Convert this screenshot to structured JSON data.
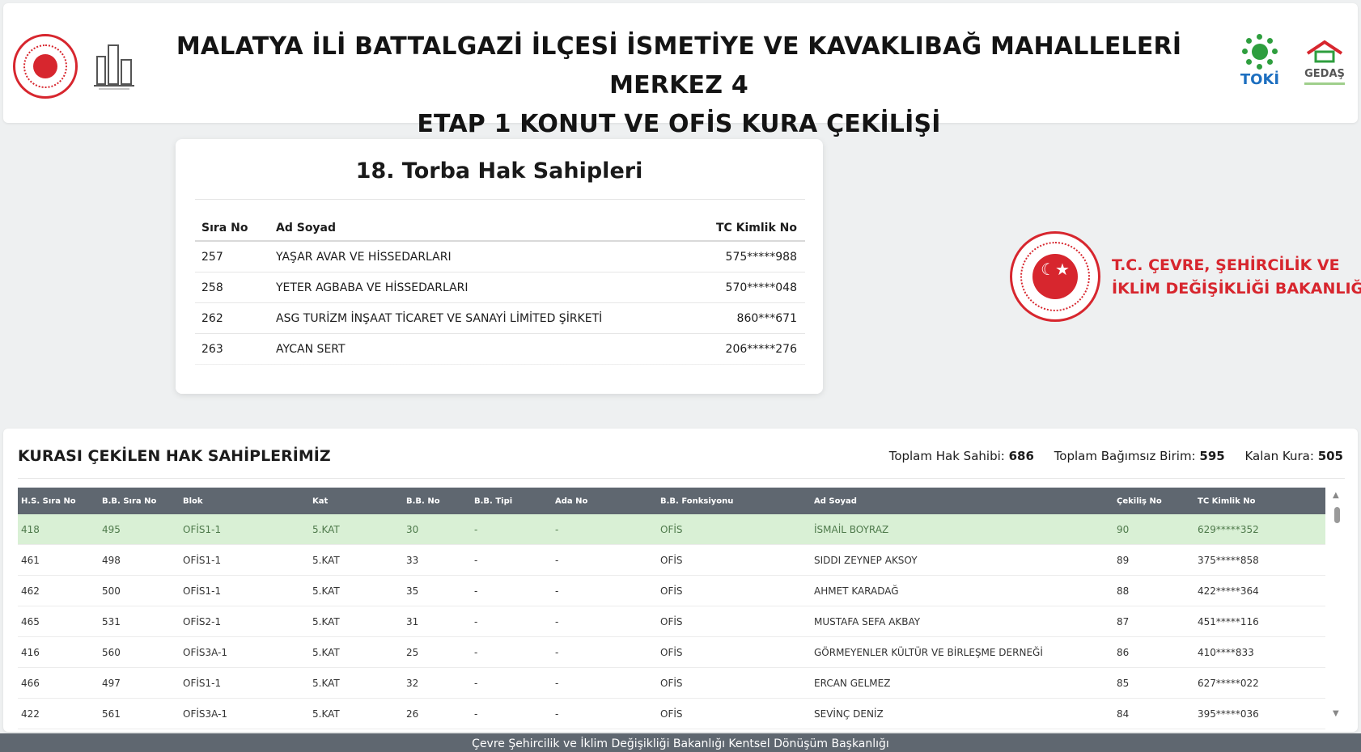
{
  "header": {
    "title_line1": "MALATYA İLİ BATTALGAZİ İLÇESİ İSMETİYE VE KAVAKLIBAĞ MAHALLELERİ MERKEZ 4",
    "title_line2": "ETAP 1 KONUT VE OFİS KURA ÇEKİLİŞİ",
    "toki_label": "TOKİ",
    "gedas_label": "GEDAŞ"
  },
  "torba": {
    "title": "18. Torba Hak Sahipleri",
    "columns": {
      "sira": "Sıra No",
      "ad": "Ad Soyad",
      "tc": "TC Kimlik No"
    },
    "rows": [
      {
        "sira": "257",
        "ad": "YAŞAR AVAR VE HİSSEDARLARI",
        "tc": "575*****988"
      },
      {
        "sira": "258",
        "ad": "YETER AGBABA VE HİSSEDARLARI",
        "tc": "570*****048"
      },
      {
        "sira": "262",
        "ad": "ASG TURİZM İNŞAAT TİCARET VE SANAYİ LİMİTED ŞİRKETİ",
        "tc": "860***671"
      },
      {
        "sira": "263",
        "ad": "AYCAN SERT",
        "tc": "206*****276"
      }
    ]
  },
  "ministry": {
    "line1": "T.C. ÇEVRE, ŞEHİRCİLİK VE",
    "line2": "İKLİM DEĞİŞİKLİĞİ BAKANLIĞI"
  },
  "drawn": {
    "title": "KURASI ÇEKİLEN HAK SAHİPLERİMİZ",
    "stats": {
      "toplam_hak_label": "Toplam Hak Sahibi:",
      "toplam_hak_value": "686",
      "toplam_birim_label": "Toplam Bağımsız Birim:",
      "toplam_birim_value": "595",
      "kalan_label": "Kalan Kura:",
      "kalan_value": "505"
    },
    "columns": {
      "hs_sira": "H.S. Sıra No",
      "bb_sira": "B.B. Sıra No",
      "blok": "Blok",
      "kat": "Kat",
      "bb_no": "B.B. No",
      "bb_tipi": "B.B. Tipi",
      "ada": "Ada No",
      "fonksiyon": "B.B. Fonksiyonu",
      "ad": "Ad Soyad",
      "cekilis": "Çekiliş No",
      "tc": "TC Kimlik No"
    },
    "rows": [
      {
        "hs_sira": "418",
        "bb_sira": "495",
        "blok": "OFİS1-1",
        "kat": "5.KAT",
        "bb_no": "30",
        "bb_tipi": "-",
        "ada": "-",
        "fonksiyon": "OFİS",
        "ad": "İSMAİL BOYRAZ",
        "cekilis": "90",
        "tc": "629*****352"
      },
      {
        "hs_sira": "461",
        "bb_sira": "498",
        "blok": "OFİS1-1",
        "kat": "5.KAT",
        "bb_no": "33",
        "bb_tipi": "-",
        "ada": "-",
        "fonksiyon": "OFİS",
        "ad": "SIDDI ZEYNEP AKSOY",
        "cekilis": "89",
        "tc": "375*****858"
      },
      {
        "hs_sira": "462",
        "bb_sira": "500",
        "blok": "OFİS1-1",
        "kat": "5.KAT",
        "bb_no": "35",
        "bb_tipi": "-",
        "ada": "-",
        "fonksiyon": "OFİS",
        "ad": "AHMET KARADAĞ",
        "cekilis": "88",
        "tc": "422*****364"
      },
      {
        "hs_sira": "465",
        "bb_sira": "531",
        "blok": "OFİS2-1",
        "kat": "5.KAT",
        "bb_no": "31",
        "bb_tipi": "-",
        "ada": "-",
        "fonksiyon": "OFİS",
        "ad": "MUSTAFA SEFA AKBAY",
        "cekilis": "87",
        "tc": "451*****116"
      },
      {
        "hs_sira": "416",
        "bb_sira": "560",
        "blok": "OFİS3A-1",
        "kat": "5.KAT",
        "bb_no": "25",
        "bb_tipi": "-",
        "ada": "-",
        "fonksiyon": "OFİS",
        "ad": "GÖRMEYENLER KÜLTÜR VE BİRLEŞME DERNEĞİ",
        "cekilis": "86",
        "tc": "410****833"
      },
      {
        "hs_sira": "466",
        "bb_sira": "497",
        "blok": "OFİS1-1",
        "kat": "5.KAT",
        "bb_no": "32",
        "bb_tipi": "-",
        "ada": "-",
        "fonksiyon": "OFİS",
        "ad": "ERCAN GELMEZ",
        "cekilis": "85",
        "tc": "627*****022"
      },
      {
        "hs_sira": "422",
        "bb_sira": "561",
        "blok": "OFİS3A-1",
        "kat": "5.KAT",
        "bb_no": "26",
        "bb_tipi": "-",
        "ada": "-",
        "fonksiyon": "OFİS",
        "ad": "SEVİNÇ DENİZ",
        "cekilis": "84",
        "tc": "395*****036"
      }
    ]
  },
  "footer": {
    "text": "Çevre Şehircilik ve İklim Değişikliği Bakanlığı Kentsel Dönüşüm Başkanlığı"
  },
  "colors": {
    "accent_red": "#d7262e",
    "toki_blue": "#1d6fc0",
    "toki_green": "#2e9e3e",
    "header_gray": "#5f6770",
    "active_row": "#d9f0d5"
  }
}
